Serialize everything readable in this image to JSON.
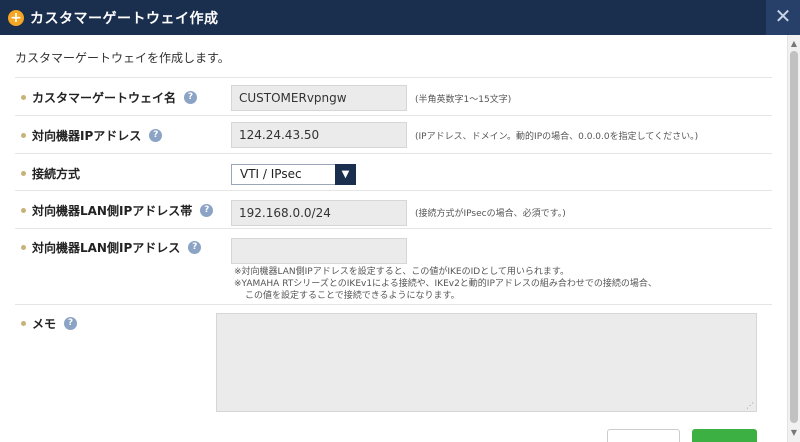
{
  "window": {
    "title": "カスタマーゲートウェイ作成",
    "close_glyph": "✕"
  },
  "description": "カスタマーゲートウェイを作成します。",
  "fields": {
    "name": {
      "label": "カスタマーゲートウェイ名",
      "value": "CUSTOMERvpngw",
      "hint": "(半角英数字1～15文字)"
    },
    "peer_ip": {
      "label": "対向機器IPアドレス",
      "value": "124.24.43.50",
      "hint": "(IPアドレス、ドメイン。動的IPの場合、0.0.0.0を指定してください。)"
    },
    "connection": {
      "label": "接続方式",
      "selected": "VTI / IPsec"
    },
    "lan_range": {
      "label": "対向機器LAN側IPアドレス帯",
      "value": "192.168.0.0/24",
      "hint": "(接続方式がIPsecの場合、必須です。)"
    },
    "lan_ip": {
      "label": "対向機器LAN側IPアドレス",
      "value": "",
      "notes": [
        "※対向機器LAN側IPアドレスを設定すると、この値がIKEのIDとして用いられます。",
        "※YAMAHA RTシリーズとのIKEv1による接続や、IKEv2と動的IPアドレスの組み合わせでの接続の場合、",
        "この値を設定することで接続できるようになります。"
      ]
    },
    "memo": {
      "label": "メモ",
      "value": ""
    }
  },
  "help_glyph": "?",
  "icons": {
    "title": "plus-circle-icon",
    "help": "question-circle-icon",
    "select": "chevron-down-icon",
    "close": "close-icon"
  },
  "colors": {
    "titlebar": "#1a2e4e",
    "accent": "#f5a623",
    "primary_button": "#3cb043",
    "help_icon": "#8ba3c4"
  }
}
